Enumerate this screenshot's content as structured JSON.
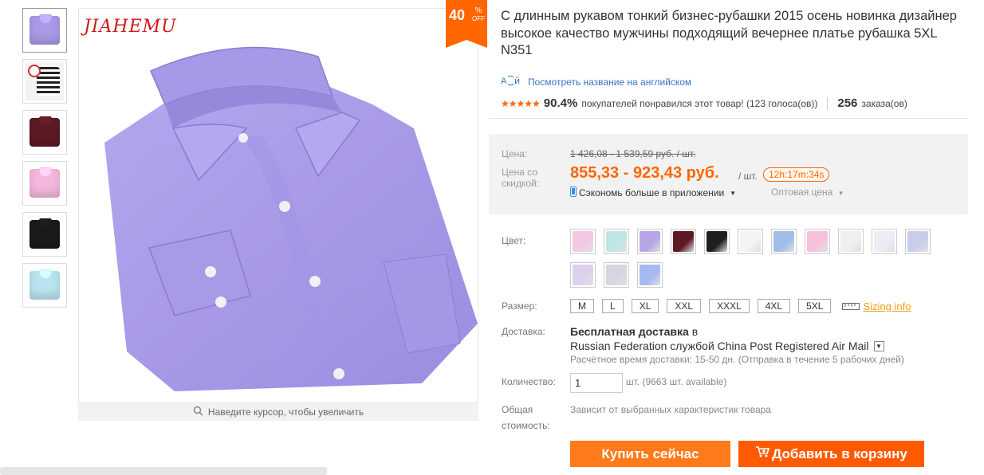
{
  "gallery": {
    "thumbnails": [
      {
        "name": "lavender",
        "color": "#a99ae6"
      },
      {
        "name": "size-chart",
        "color": "#333333"
      },
      {
        "name": "burgundy",
        "color": "#5b1a22"
      },
      {
        "name": "pink",
        "color": "#f3b8dc"
      },
      {
        "name": "black",
        "color": "#1a1a1a"
      },
      {
        "name": "light-blue",
        "color": "#b9e4ef"
      }
    ],
    "brand_logo": "JIAHEMU",
    "zoom_hint": "Наведите курсор, чтобы увеличить",
    "discount": {
      "value": "40",
      "symbol": "%",
      "label": "OFF"
    }
  },
  "product": {
    "title": "С длинным рукавом тонкий бизнес-рубашки 2015 осень новинка дизайнер высокое качество мужчины подходящий вечернее платье рубашка 5XL N351",
    "translate_link": "Посмотреть название на английском",
    "rating": {
      "stars_value": 4.5,
      "percent": "90.4%",
      "text": "покупателей понравился этот товар! (123 голоса(ов))",
      "orders_count": "256",
      "orders_label": "заказа(ов)"
    }
  },
  "price": {
    "price_label": "Цена:",
    "original": "1 426,08 - 1 539,59 руб. / шт.",
    "discount_label": "Цена со скидкой:",
    "sale": "855,33 - 923,43 руб.",
    "unit": "/ шт.",
    "timer": "12h:17m:34s",
    "app_promo": "Сэкономь больше в приложении",
    "wholesale": "Оптовая цена"
  },
  "options": {
    "color_label": "Цвет:",
    "colors": [
      "#f2c9e2",
      "#bfe6e6",
      "#b6a6e6",
      "#5d1a25",
      "#1f1f1f",
      "#f4f4f4",
      "#9ebde8",
      "#f6c2db",
      "#efefef",
      "#ececf4",
      "#c8cdea",
      "#dcd2ec",
      "#d6d6e0",
      "#a8b8f0"
    ],
    "size_label": "Размер:",
    "sizes": [
      "M",
      "L",
      "XL",
      "XXL",
      "XXXL",
      "4XL",
      "5XL"
    ],
    "sizing_info": "Sizing info"
  },
  "shipping": {
    "label": "Доставка:",
    "free": "Бесплатная доставка",
    "to": "в",
    "destination": "Russian Federation службой China Post Registered Air Mail",
    "estimate": "Расчётное время доставки: 15-50 дн. (Отправка в течение 5 рабочих дней)"
  },
  "quantity": {
    "label": "Количество:",
    "value": "1",
    "note": "шт. (9663 шт. available)"
  },
  "total": {
    "label": "Общая стоимость:",
    "value": "Зависит от выбранных характеристик товара"
  },
  "actions": {
    "buy_now": "Купить сейчас",
    "add_to_cart": "Добавить в корзину"
  }
}
